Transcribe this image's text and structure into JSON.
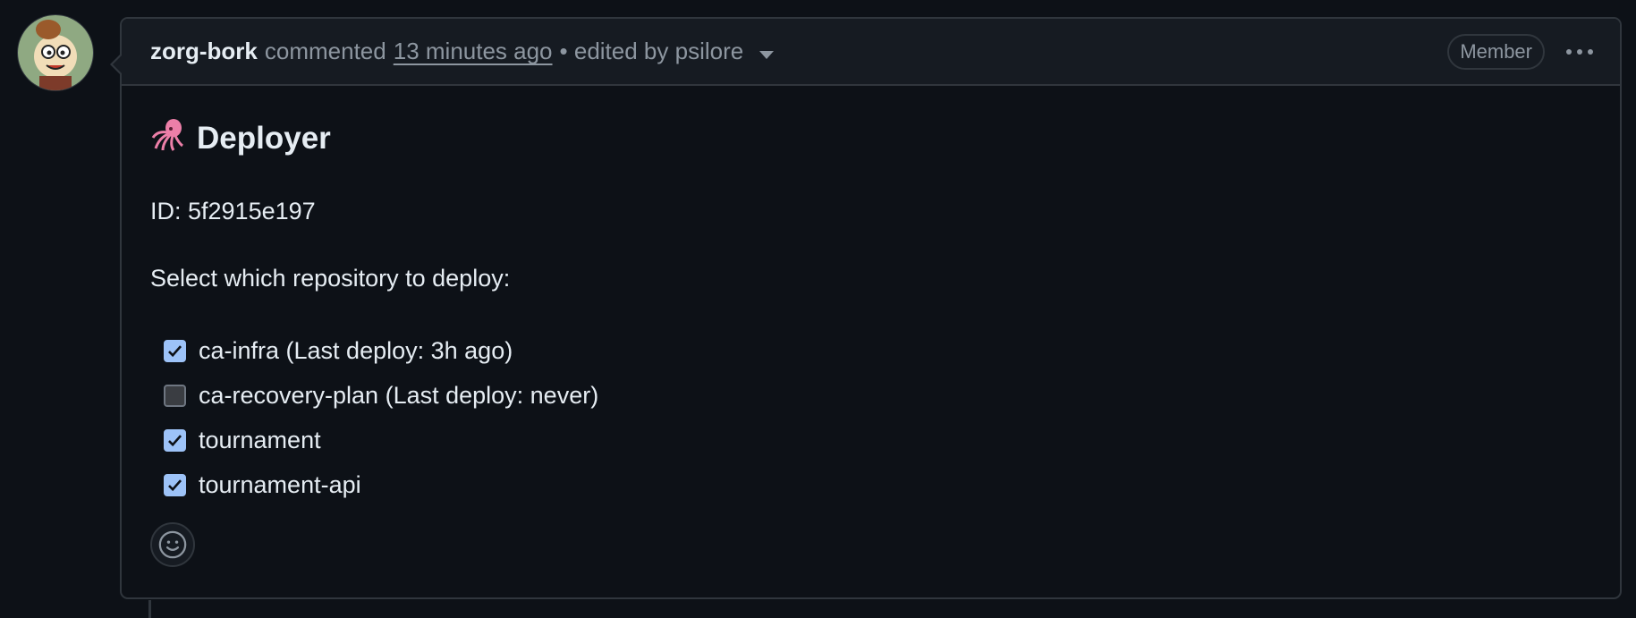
{
  "comment": {
    "author": "zorg-bork",
    "action": "commented",
    "timestamp": "13 minutes ago",
    "edited_text": "• edited by psilore",
    "badge": "Member"
  },
  "body": {
    "heading_emoji": "squid-icon",
    "heading": "Deployer",
    "id_line": "ID: 5f2915e197",
    "prompt": "Select which repository to deploy:",
    "tasks": [
      {
        "label": "ca-infra (Last deploy: 3h ago)",
        "checked": true
      },
      {
        "label": "ca-recovery-plan (Last deploy: never)",
        "checked": false
      },
      {
        "label": "tournament",
        "checked": true
      },
      {
        "label": "tournament-api",
        "checked": true
      }
    ]
  },
  "colors": {
    "background": "#0d1117",
    "header_bg": "#161b22",
    "border": "#30363d",
    "text": "#e6edf3",
    "muted": "#8d96a0",
    "checkbox_checked": "#9dc3f8"
  }
}
